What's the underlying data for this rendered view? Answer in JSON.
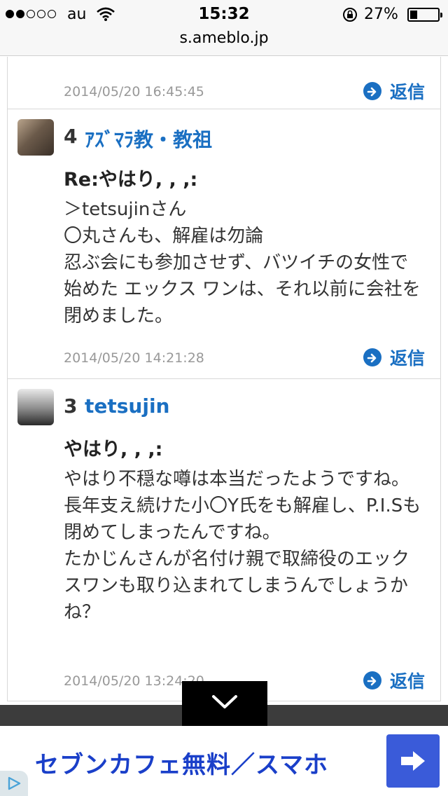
{
  "status_bar": {
    "carrier": "au",
    "time": "15:32",
    "battery_percent": "27%",
    "battery_level": 0.27,
    "signal_bars_filled": 2,
    "signal_bars_total": 5
  },
  "url_bar": {
    "url": "s.ameblo.jp"
  },
  "colors": {
    "link": "#1a6fc2",
    "ad_text": "#1a3fc9",
    "ad_button": "#3a5bd9"
  },
  "partial_comment": {
    "timestamp": "2014/05/20 16:45:45",
    "reply_label": "返信"
  },
  "comments": [
    {
      "number": "4",
      "author": "ｱｽﾞﾏﾗ教・教祖",
      "title": "Re:やはり, , ,:",
      "body": [
        "＞tetsujinさん",
        "〇丸さんも、解雇は勿論",
        "忍ぶ会にも参加させず、バツイチの女性で始めた エックス ワンは、それ以前に会社を閉めました。"
      ],
      "timestamp": "2014/05/20 14:21:28",
      "reply_label": "返信"
    },
    {
      "number": "3",
      "author": "tetsujin",
      "title": "やはり, , ,:",
      "body": [
        "やはり不穏な噂は本当だったようですね。",
        "長年支え続けた小〇Y氏をも解雇し、P.I.Sも閉めてしまったんですね。",
        "たかじんさんが名付け親で取締役のエックスワンも取り込まれてしまうんでしょうかね？"
      ],
      "timestamp": "2014/05/20 13:24:20",
      "reply_label": "返信"
    }
  ],
  "ad": {
    "text": "セブンカフェ無料／スマホ",
    "arrow_icon": "right-arrow-icon",
    "badge_icon": "play-triangle-icon"
  },
  "collapse_icon": "chevron-down-icon"
}
